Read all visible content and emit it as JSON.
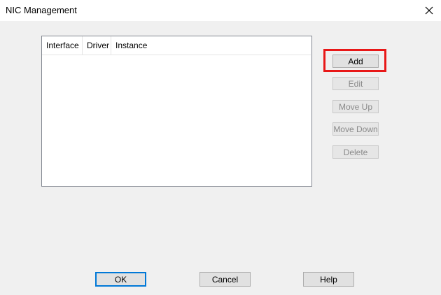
{
  "window": {
    "title": "NIC Management",
    "close_icon": "close-icon"
  },
  "list": {
    "columns": [
      "Interface",
      "Driver",
      "Instance"
    ],
    "rows": []
  },
  "side_buttons": {
    "add": "Add",
    "edit": "Edit",
    "move_up": "Move Up",
    "move_down": "Move Down",
    "delete": "Delete"
  },
  "footer_buttons": {
    "ok": "OK",
    "cancel": "Cancel",
    "help": "Help"
  },
  "colors": {
    "highlight": "#e81818",
    "default_button_border": "#0078d7",
    "disabled_text": "#8a8a8a"
  }
}
